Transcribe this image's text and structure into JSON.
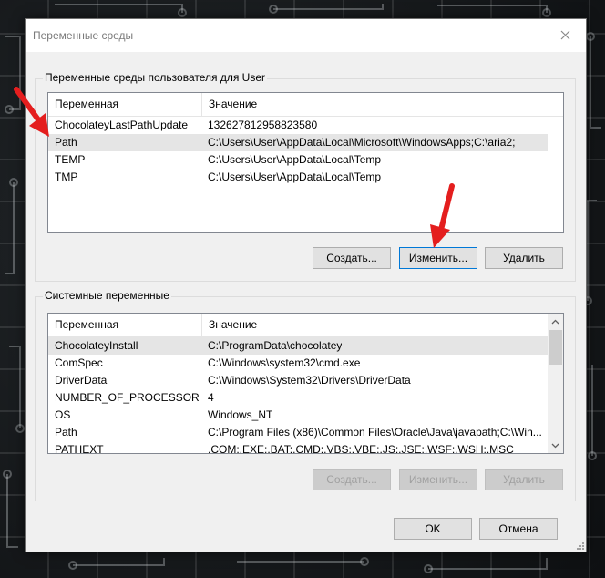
{
  "window": {
    "title": "Переменные среды"
  },
  "user_vars": {
    "group_label": "Переменные среды пользователя для User",
    "columns": [
      "Переменная",
      "Значение"
    ],
    "rows": [
      {
        "name": "ChocolateyLastPathUpdate",
        "value": "132627812958823580"
      },
      {
        "name": "Path",
        "value": "C:\\Users\\User\\AppData\\Local\\Microsoft\\WindowsApps;C:\\aria2;"
      },
      {
        "name": "TEMP",
        "value": "C:\\Users\\User\\AppData\\Local\\Temp"
      },
      {
        "name": "TMP",
        "value": "C:\\Users\\User\\AppData\\Local\\Temp"
      }
    ],
    "selected_row": "Path",
    "buttons": {
      "new": "Создать...",
      "edit": "Изменить...",
      "delete": "Удалить"
    }
  },
  "system_vars": {
    "group_label": "Системные переменные",
    "columns": [
      "Переменная",
      "Значение"
    ],
    "rows": [
      {
        "name": "ChocolateyInstall",
        "value": "C:\\ProgramData\\chocolatey"
      },
      {
        "name": "ComSpec",
        "value": "C:\\Windows\\system32\\cmd.exe"
      },
      {
        "name": "DriverData",
        "value": "C:\\Windows\\System32\\Drivers\\DriverData"
      },
      {
        "name": "NUMBER_OF_PROCESSORS",
        "value": "4"
      },
      {
        "name": "OS",
        "value": "Windows_NT"
      },
      {
        "name": "Path",
        "value": "C:\\Program Files (x86)\\Common Files\\Oracle\\Java\\javapath;C:\\Win..."
      },
      {
        "name": "PATHEXT",
        "value": ".COM;.EXE;.BAT;.CMD;.VBS;.VBE;.JS;.JSE;.WSF;.WSH;.MSC"
      }
    ],
    "selected_row": "ChocolateyInstall",
    "buttons": {
      "new": "Создать...",
      "edit": "Изменить...",
      "delete": "Удалить"
    }
  },
  "footer": {
    "ok": "OK",
    "cancel": "Отмена"
  },
  "colors": {
    "annotation_arrow": "#e41e1e",
    "focus_border": "#0078d7"
  }
}
